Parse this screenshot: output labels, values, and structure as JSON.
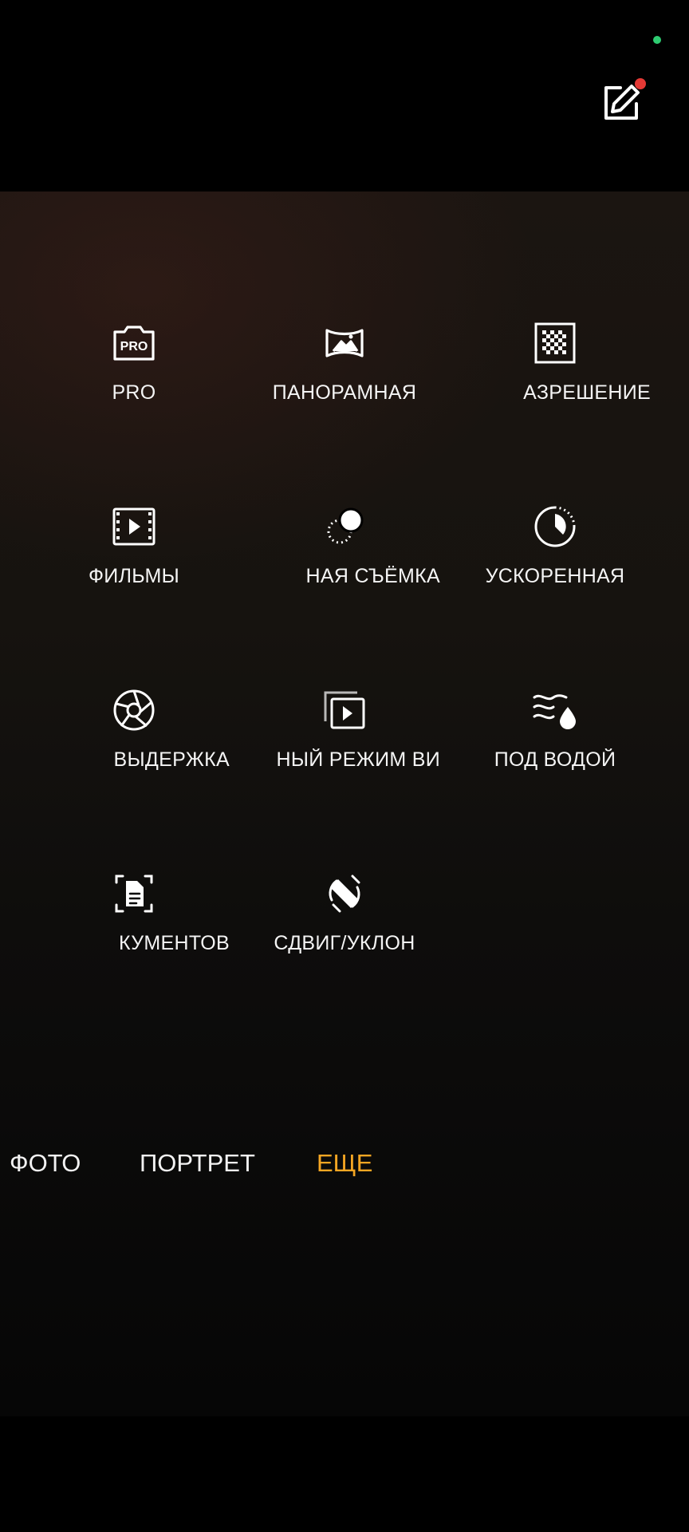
{
  "header": {
    "edit_icon": "edit-pencil-icon"
  },
  "modes": [
    {
      "label": "PRO",
      "icon": "pro-camera-icon"
    },
    {
      "label": "ПАНОРАМНАЯ",
      "icon": "panorama-icon"
    },
    {
      "label": "АЗРЕШЕНИЕ",
      "icon": "high-resolution-icon"
    },
    {
      "label": "ФИЛЬМЫ",
      "icon": "film-icon"
    },
    {
      "label": "НАЯ СЪЁМКА",
      "icon": "dual-capture-icon"
    },
    {
      "label": "УСКОРЕННАЯ",
      "icon": "timelapse-icon"
    },
    {
      "label": "ВЫДЕРЖКА",
      "icon": "shutter-aperture-icon"
    },
    {
      "label": "НЫЙ РЕЖИМ ВИ",
      "icon": "video-mode-icon"
    },
    {
      "label": "ПОД ВОДОЙ",
      "icon": "underwater-icon"
    },
    {
      "label": "КУМЕНТОВ",
      "icon": "document-scan-icon"
    },
    {
      "label": "СДВИГ/УКЛОН",
      "icon": "tilt-shift-icon"
    }
  ],
  "mode_bar": {
    "items": [
      {
        "label": "ФОТО",
        "active": false
      },
      {
        "label": "ПОРТРЕТ",
        "active": false
      },
      {
        "label": "ЕЩЕ",
        "active": true
      }
    ]
  },
  "colors": {
    "accent": "#f5a623",
    "status_dot": "#2ecc71",
    "badge": "#e53935"
  }
}
